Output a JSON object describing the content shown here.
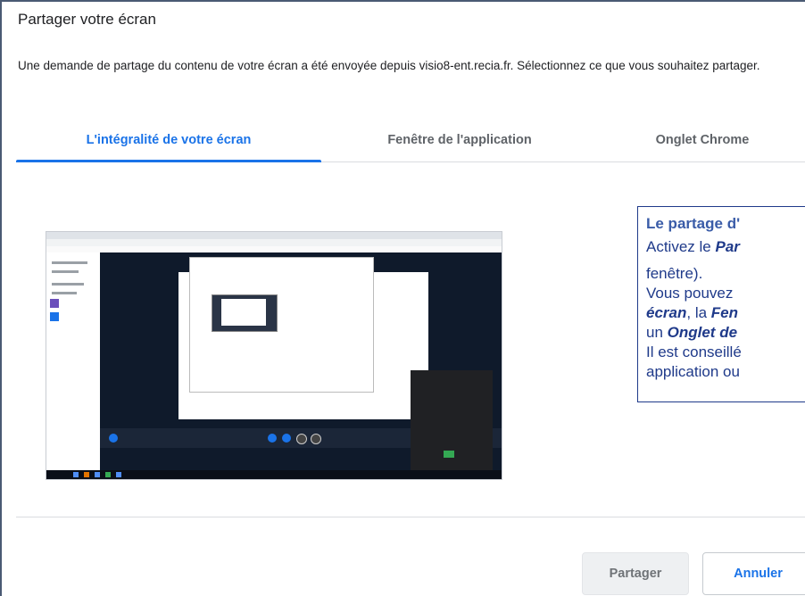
{
  "dialog": {
    "title": "Partager votre écran",
    "description": "Une demande de partage du contenu de votre écran a été envoyée depuis visio8-ent.recia.fr. Sélectionnez ce que vous souhaitez partager."
  },
  "tabs": [
    {
      "label": "L'intégralité de votre écran",
      "active": true
    },
    {
      "label": "Fenêtre de l'application",
      "active": false
    },
    {
      "label": "Onglet Chrome",
      "active": false
    }
  ],
  "callout": {
    "title": "Le partage d'",
    "line1_prefix": "Activez le ",
    "line1_bold": "Par",
    "line2": "fenêtre).",
    "line3": "Vous pouvez",
    "line4_bold": "écran",
    "line4_mid": ", la ",
    "line4_bold2": "Fen",
    "line5_prefix": "un ",
    "line5_bold": "Onglet de",
    "line6": "Il est conseillé",
    "line7": "application ou"
  },
  "buttons": {
    "share_label": "Partager",
    "cancel_label": "Annuler"
  },
  "colors": {
    "accent": "#1a73e8",
    "callout_border": "#1f3a8a"
  }
}
